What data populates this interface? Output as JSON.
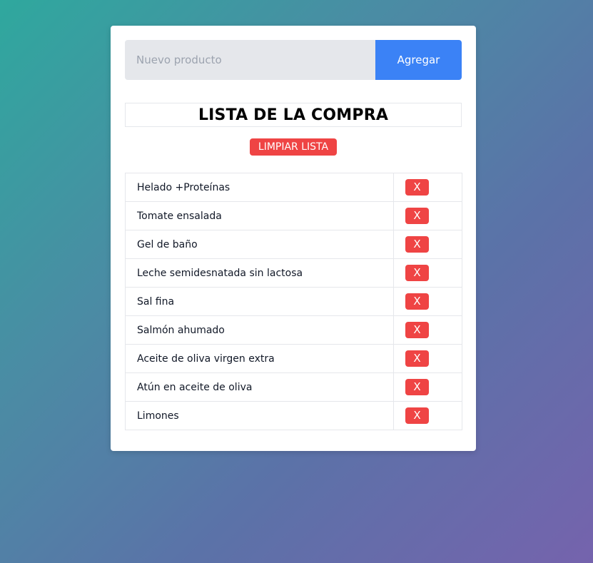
{
  "form": {
    "input_placeholder": "Nuevo producto",
    "input_value": "",
    "add_label": "Agregar"
  },
  "list": {
    "title": "LISTA DE LA COMPRA",
    "clear_label": "LIMPIAR LISTA",
    "delete_label": "X",
    "items": [
      "Helado +Proteínas",
      "Tomate ensalada",
      "Gel de baño",
      "Leche semidesnatada sin lactosa",
      "Sal fina",
      "Salmón ahumado",
      "Aceite de oliva virgen extra",
      "Atún en aceite de oliva",
      "Limones"
    ]
  },
  "colors": {
    "primary": "#3b82f6",
    "danger": "#ef4444",
    "input_bg": "#e5e7eb",
    "gradient_start": "#2fa89e",
    "gradient_end": "#7563ad"
  }
}
